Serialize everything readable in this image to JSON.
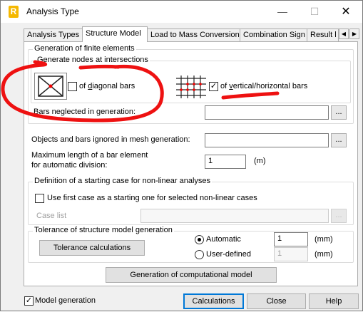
{
  "window": {
    "title": "Analysis Type",
    "app_icon_letter": "R",
    "minimize_glyph": "—",
    "maximize_glyph": "☐",
    "close_glyph": "✕"
  },
  "tabs": [
    {
      "label": "Analysis Types",
      "active": false
    },
    {
      "label": "Structure Model",
      "active": true
    },
    {
      "label": "Load to Mass Conversion",
      "active": false
    },
    {
      "label": "Combination Sign",
      "active": false
    },
    {
      "label": "Result l",
      "active": false
    }
  ],
  "tab_scroll": {
    "left": "◀",
    "right": "▶"
  },
  "generation": {
    "group_title": "Generation of finite elements",
    "nodes_group_title": "Generate nodes at intersections",
    "diagonal_label_pre": "of ",
    "diagonal_label_underlined": "d",
    "diagonal_label_post": "iagonal bars",
    "diagonal_checked": false,
    "vh_label_pre": "of ",
    "vh_label_underlined": "v",
    "vh_label_post": "ertical/horizontal bars",
    "vh_checked": true,
    "check_glyph": "✓",
    "bars_neglected_label": "Bars neglected in generation:",
    "bars_neglected_value": "",
    "browse_label": "..."
  },
  "mesh": {
    "objects_ignored_label": "Objects and bars ignored in mesh generation:",
    "objects_ignored_value": "",
    "max_length_label_1": "Maximum length of a bar element",
    "max_length_label_2": "for automatic division:",
    "max_length_value": "1",
    "max_length_unit": "(m)"
  },
  "nonlinear": {
    "group_title": "Definition of a starting case for non-linear analyses",
    "use_first_case_label": "Use first case as a starting one for selected non-linear cases",
    "use_first_case_checked": false,
    "case_list_label": "Case list",
    "case_list_value": ""
  },
  "tolerance": {
    "group_title": "Tolerance of structure model generation",
    "calc_button": "Tolerance calculations",
    "automatic_label": "Automatic",
    "automatic_selected": true,
    "automatic_value": "1",
    "user_defined_label": "User-defined",
    "user_defined_selected": false,
    "user_defined_value": "1",
    "unit": "(mm)"
  },
  "generate_model_button": "Generation of computational model",
  "footer": {
    "model_generation_label": "Model generation",
    "model_generation_checked": true,
    "calculations_button": "Calculations",
    "close_button": "Close",
    "help_button": "Help"
  },
  "colors": {
    "annotation_red": "#ee1111",
    "default_button_border": "#0078d7",
    "app_icon": "#f5b800"
  }
}
